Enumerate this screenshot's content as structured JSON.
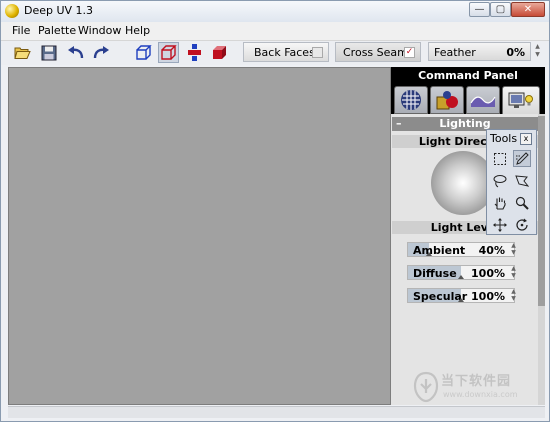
{
  "window": {
    "title": "Deep UV 1.3",
    "buttons": {
      "minimize": "—",
      "maximize": "▢",
      "close": "✕"
    }
  },
  "menu": [
    "File",
    "Palette",
    "Window",
    "Help"
  ],
  "toolbar": {
    "icons": [
      "open-folder-icon",
      "save-disk-icon",
      "undo-icon",
      "redo-icon",
      "cube-wire-icon",
      "cube-select-icon",
      "vertex-nodes-icon",
      "cube-faces-icon"
    ],
    "back_faces": {
      "label": "Back Faces",
      "checked": false
    },
    "cross_seams": {
      "label": "Cross Seams",
      "checked": true,
      "check_glyph": "✓"
    },
    "feather": {
      "label": "Feather",
      "value": "0%"
    }
  },
  "command_panel": {
    "title": "Command Panel",
    "tabs": [
      "checker-sphere-icon",
      "shapes-icon",
      "wave-map-icon",
      "monitor-light-icon"
    ],
    "lighting": {
      "section": "Lighting",
      "collapse_glyph": "–",
      "light_direction": "Light Direction",
      "light_level": "Light Level",
      "sliders": [
        {
          "label": "Ambient",
          "value": "40%",
          "level": 0.4
        },
        {
          "label": "Diffuse",
          "value": "100%",
          "level": 1.0
        },
        {
          "label": "Specular",
          "value": "100%",
          "level": 1.0
        }
      ]
    }
  },
  "tools_palette": {
    "title": "Tools",
    "close": "x",
    "tools": [
      "rect-select-icon",
      "brush-select-icon",
      "lasso-icon",
      "poly-lasso-icon",
      "pan-hand-icon",
      "zoom-icon",
      "move-icon",
      "rotate-icon"
    ]
  },
  "watermark": {
    "text": "当下软件园",
    "url": "www.downxia.com"
  },
  "colors": {
    "viewport": "#a1a1a1",
    "panel_header": "#000000",
    "accent_red": "#c01020",
    "accent_blue": "#1f3fbf"
  }
}
